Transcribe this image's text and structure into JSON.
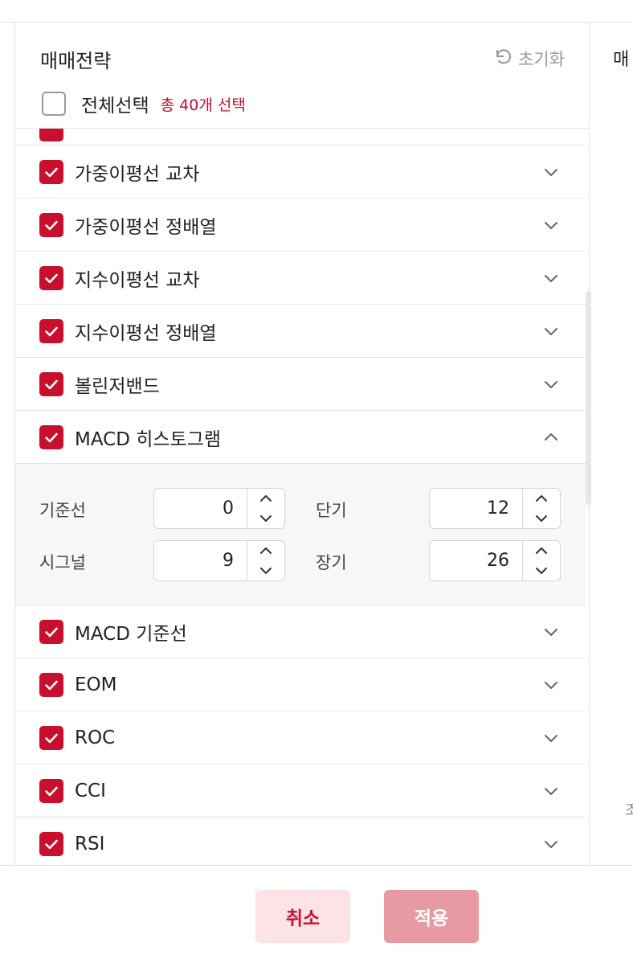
{
  "panel": {
    "title": "매매전략",
    "reset_label": "초기화",
    "select_all_label": "전체선택",
    "selected_count": "총 40개 선택"
  },
  "strategies": [
    {
      "label": "가중이평선 교차",
      "checked": true,
      "expanded": false
    },
    {
      "label": "가중이평선 정배열",
      "checked": true,
      "expanded": false
    },
    {
      "label": "지수이평선 교차",
      "checked": true,
      "expanded": false
    },
    {
      "label": "지수이평선 정배열",
      "checked": true,
      "expanded": false
    },
    {
      "label": "볼린저밴드",
      "checked": true,
      "expanded": false
    },
    {
      "label": "MACD 히스토그램",
      "checked": true,
      "expanded": true
    },
    {
      "label": "MACD 기준선",
      "checked": true,
      "expanded": false
    },
    {
      "label": "EOM",
      "checked": true,
      "expanded": false
    },
    {
      "label": "ROC",
      "checked": true,
      "expanded": false
    },
    {
      "label": "CCI",
      "checked": true,
      "expanded": false
    },
    {
      "label": "RSI",
      "checked": true,
      "expanded": false
    }
  ],
  "macd_params": {
    "baseline": {
      "label": "기준선",
      "value": "0"
    },
    "short": {
      "label": "단기",
      "value": "12"
    },
    "signal": {
      "label": "시그널",
      "value": "9"
    },
    "long": {
      "label": "장기",
      "value": "26"
    }
  },
  "right_panel_peek": {
    "title_fragment": "매",
    "bottom_fragment": "조"
  },
  "footer": {
    "cancel_label": "취소",
    "apply_label": "적용"
  },
  "colors": {
    "accent": "#c8102e",
    "apply_disabled": "#e89aa4",
    "cancel_bg": "#fbe3e6"
  },
  "icons": {
    "reset": "rotate-ccw-icon",
    "checkbox": "check-icon",
    "collapsed": "chevron-down-icon",
    "expanded": "chevron-up-icon"
  }
}
